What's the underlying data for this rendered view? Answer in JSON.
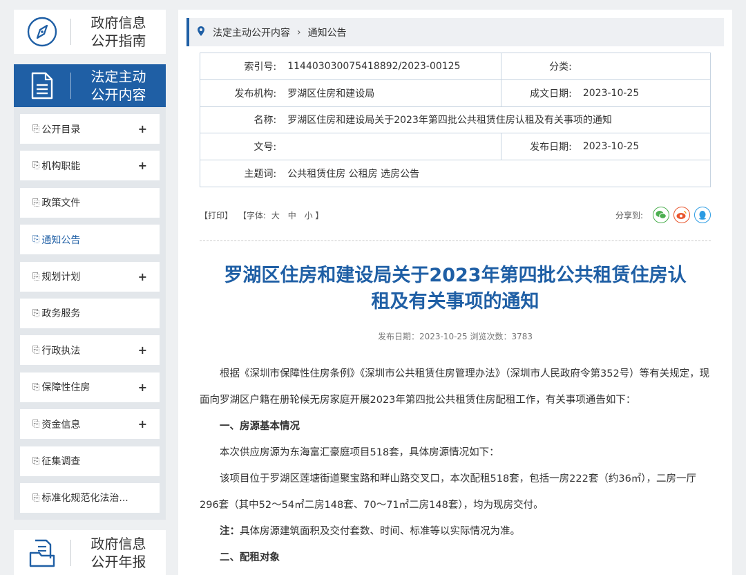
{
  "sidebar": {
    "guide": {
      "line1": "政府信息",
      "line2": "公开指南"
    },
    "active_section": {
      "line1": "法定主动",
      "line2": "公开内容"
    },
    "items": [
      {
        "label": "公开目录",
        "expand": "+"
      },
      {
        "label": "机构职能",
        "expand": "+"
      },
      {
        "label": "政策文件",
        "expand": ""
      },
      {
        "label": "通知公告",
        "expand": ""
      },
      {
        "label": "规划计划",
        "expand": "+"
      },
      {
        "label": "政务服务",
        "expand": ""
      },
      {
        "label": "行政执法",
        "expand": "+"
      },
      {
        "label": "保障性住房",
        "expand": "+"
      },
      {
        "label": "资金信息",
        "expand": "+"
      },
      {
        "label": "征集调查",
        "expand": ""
      },
      {
        "label": "标准化规范化法治...",
        "expand": ""
      }
    ],
    "annual_report": {
      "line1": "政府信息",
      "line2": "公开年报"
    }
  },
  "breadcrumb": {
    "level1": "法定主动公开内容",
    "separator": "›",
    "level2": "通知公告"
  },
  "meta": {
    "index_label": "索引号:",
    "index_value": "114403030075418892/2023-00125",
    "category_label": "分类:",
    "category_value": "",
    "org_label": "发布机构:",
    "org_value": "罗湖区住房和建设局",
    "written_label": "成文日期:",
    "written_value": "2023-10-25",
    "name_label": "名称:",
    "name_value": "罗湖区住房和建设局关于2023年第四批公共租赁住房认租及有关事项的通知",
    "docno_label": "文号:",
    "docno_value": "",
    "pubdate_label": "发布日期:",
    "pubdate_value": "2023-10-25",
    "subject_label": "主题词:",
    "subject_value": "公共租赁住房 公租房 选房公告"
  },
  "toolbar": {
    "print": "【打印】",
    "font_prefix": "【字体:",
    "font_large": "大",
    "font_medium": "中",
    "font_small": "小",
    "font_suffix": "】",
    "share_label": "分享到:"
  },
  "article": {
    "title_line1": "罗湖区住房和建设局关于2023年第四批公共租赁住房认",
    "title_line2": "租及有关事项的通知",
    "pub_info": "发布日期：2023-10-25  浏览次数：3783",
    "p1": "根据《深圳市保障性住房条例》《深圳市公共租赁住房管理办法》（深圳市人民政府令第352号）等有关规定，现面向罗湖区户籍在册轮候无房家庭开展2023年第四批公共租赁住房配租工作，有关事项通告如下：",
    "h1": "一、房源基本情况",
    "p2": "本次供应房源为东海富汇豪庭项目518套，具体房源情况如下：",
    "p3": "该项目位于罗湖区莲塘街道聚宝路和畔山路交叉口，本次配租518套，包括一房222套（约36㎡），二房一厅296套（其中52～54㎡二房148套、70～71㎡二房148套），均为现房交付。",
    "note_label": "注：",
    "note_text": "具体房源建筑面积及交付套数、时间、标准等以实际情况为准。",
    "h2": "二、配租对象"
  },
  "colors": {
    "accent": "#1f5fa5",
    "wechat": "#4caf50",
    "weibo": "#e8552d",
    "qq": "#2a9be3"
  }
}
